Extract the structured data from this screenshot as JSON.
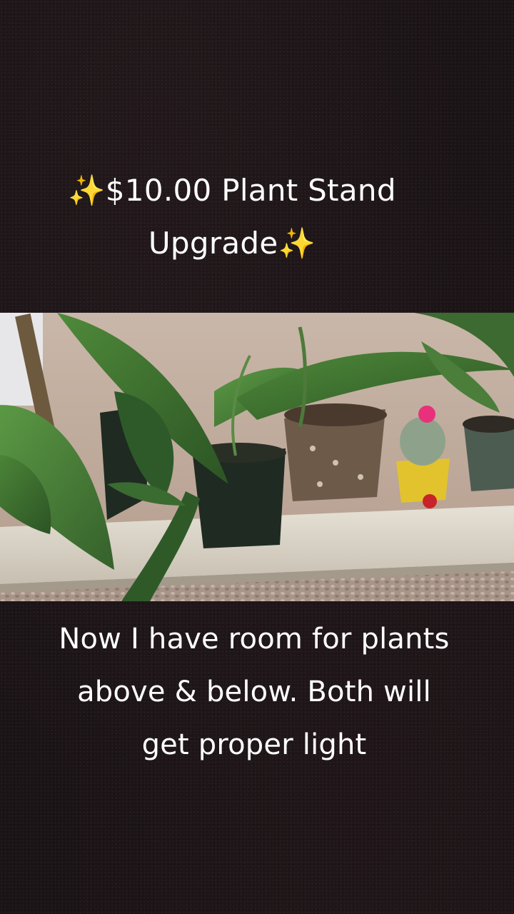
{
  "overlay": {
    "title_line1_emoji": "✨",
    "title_line1_text": "$10.00 Plant Stand",
    "title_line2_text": "Upgrade",
    "title_line2_emoji": "✨",
    "caption_lines": [
      "Now I have room for plants",
      "above & below. Both will",
      "get proper light"
    ]
  },
  "photo": {
    "subject": "potted-plants-on-window-shelf"
  },
  "colors": {
    "background": "#1b1416",
    "text": "#ffffff",
    "sparkle": "#f6c94a",
    "leaf": "#3d6b2f",
    "shelf": "#d9d3c6"
  }
}
